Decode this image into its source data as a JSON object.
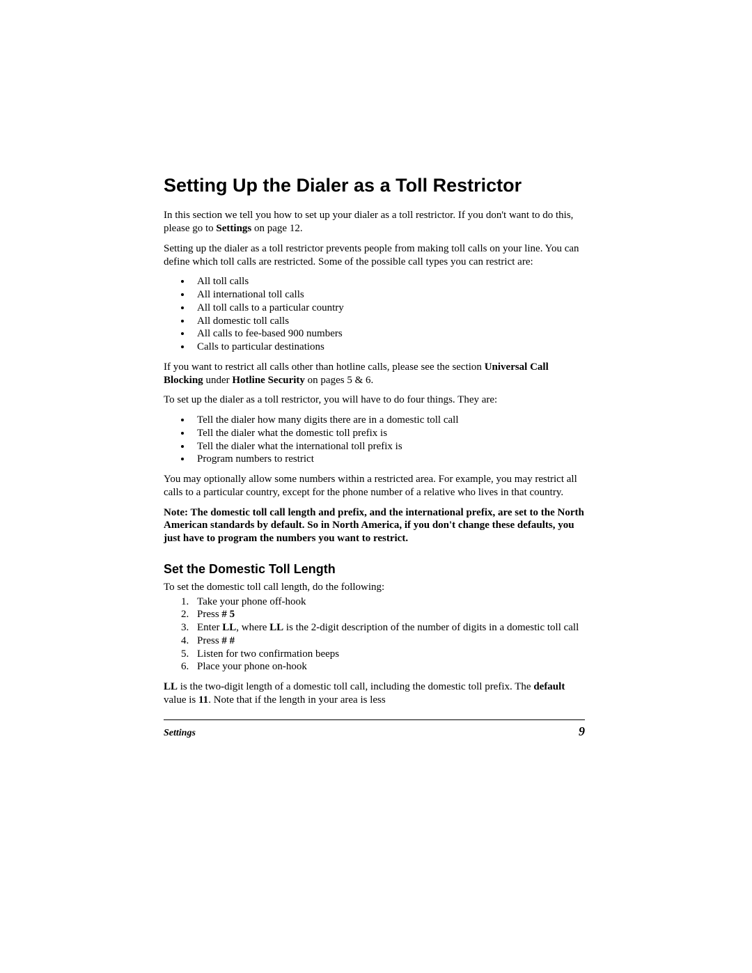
{
  "heading": "Setting Up the Dialer as a Toll Restrictor",
  "intro_p1_a": "In this section we tell you how to set up your dialer as a toll restrictor. If you don't want to do this, please go to ",
  "intro_p1_bold": "Settings",
  "intro_p1_b": " on page 12.",
  "intro_p2": "Setting up the dialer as a toll restrictor prevents people from making toll calls on your line.  You can define which toll calls are restricted.  Some of the possible call types you can restrict are:",
  "restrict_list": [
    "All toll calls",
    "All international toll calls",
    "All toll calls to a particular country",
    "All domestic toll calls",
    "All calls to fee-based 900 numbers",
    "Calls to particular destinations"
  ],
  "ucb_a": "If you want to restrict all calls other than hotline calls, please see the section ",
  "ucb_bold1": "Universal Call Blocking",
  "ucb_mid": " under ",
  "ucb_bold2": "Hotline Security",
  "ucb_b": " on pages 5 & 6.",
  "setup_intro": "To set up the dialer as a toll restrictor, you will have to do four things.  They are:",
  "setup_list": [
    "Tell the dialer how many digits there are in a domestic toll call",
    "Tell the dialer what the domestic toll prefix is",
    "Tell the dialer what the international toll prefix is",
    "Program numbers to restrict"
  ],
  "optional_p": "You may optionally allow some numbers within a restricted area.  For example, you may restrict all calls to a particular country, except for the phone number of a relative who lives in that country.",
  "note": "Note: The domestic toll call length and prefix, and the international prefix, are set to the North American standards by default.  So in North America, if you don't change these defaults, you just have to program the numbers you want to restrict.",
  "sub_heading": "Set the Domestic Toll Length",
  "steps_intro": "To set the domestic toll call length, do the following:",
  "steps": {
    "s1": "Take your phone off-hook",
    "s2a": "Press ",
    "s2b": "# 5",
    "s3a": "Enter ",
    "s3b": "LL",
    "s3c": ", where ",
    "s3d": "LL",
    "s3e": " is the 2-digit description of the number of digits in a domestic toll call",
    "s4a": "Press ",
    "s4b": "# #",
    "s5": "Listen for two confirmation beeps",
    "s6": "Place your phone on-hook"
  },
  "closing_a": "",
  "closing_b1": "LL",
  "closing_mid1": " is the two-digit length of a domestic toll call, including the domestic toll prefix.  The ",
  "closing_b2": "default",
  "closing_mid2": " value is ",
  "closing_b3": "11",
  "closing_end": ".  Note that if the length in your area is less",
  "footer_left": "Settings",
  "footer_right": "9"
}
